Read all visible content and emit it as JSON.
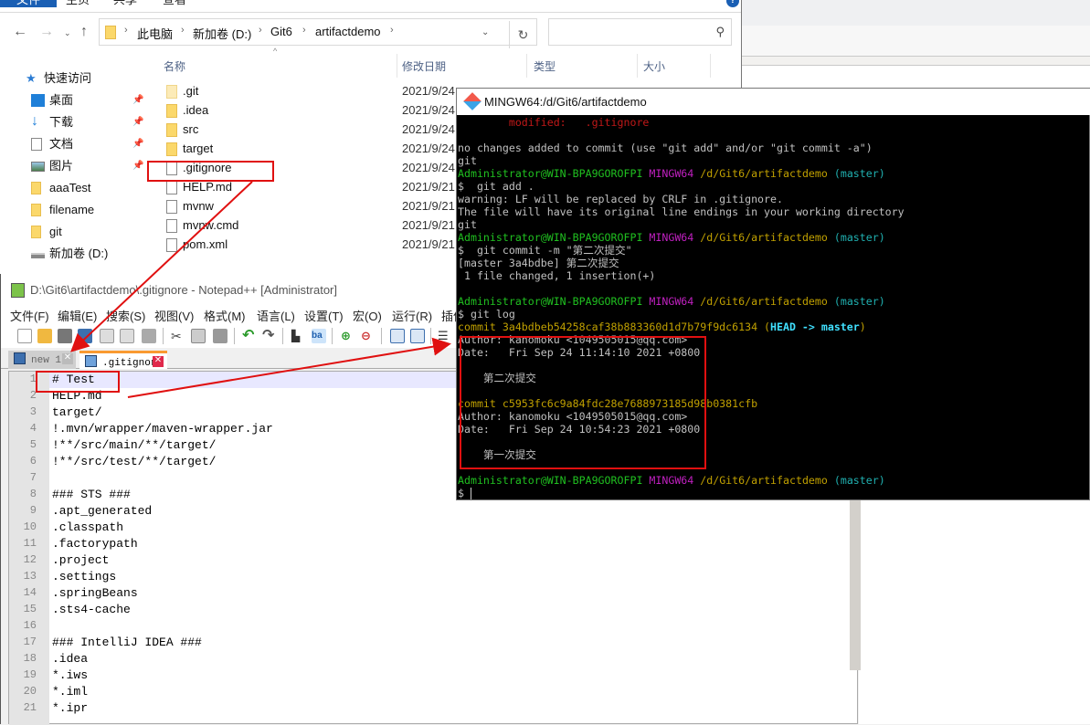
{
  "explorer": {
    "ribbon_tabs": [
      "文件",
      "主页",
      "共享",
      "查看"
    ],
    "breadcrumb": [
      "此电脑",
      "新加卷 (D:)",
      "Git6",
      "artifactdemo"
    ],
    "search_placeholder": "",
    "columns": [
      "名称",
      "修改日期",
      "类型",
      "大小"
    ],
    "sidebar": [
      {
        "label": "快速访问",
        "icon": "star-icon"
      },
      {
        "label": "桌面",
        "icon": "desktop-icon",
        "pinned": true
      },
      {
        "label": "下载",
        "icon": "download-icon",
        "pinned": true
      },
      {
        "label": "文档",
        "icon": "document-icon",
        "pinned": true
      },
      {
        "label": "图片",
        "icon": "pictures-icon",
        "pinned": true
      },
      {
        "label": "aaaTest",
        "icon": "folder-icon"
      },
      {
        "label": "filename",
        "icon": "folder-icon"
      },
      {
        "label": "git",
        "icon": "folder-icon"
      },
      {
        "label": "新加卷 (D:)",
        "icon": "drive-icon"
      }
    ],
    "files": [
      {
        "name": ".git",
        "date": "2021/9/24",
        "icon": "folder-icon"
      },
      {
        "name": ".idea",
        "date": "2021/9/24",
        "icon": "folder-icon"
      },
      {
        "name": "src",
        "date": "2021/9/24",
        "icon": "folder-icon"
      },
      {
        "name": "target",
        "date": "2021/9/24",
        "icon": "folder-icon"
      },
      {
        "name": ".gitignore",
        "date": "2021/9/24",
        "icon": "text-file-icon"
      },
      {
        "name": "HELP.md",
        "date": "2021/9/21",
        "icon": "file-icon"
      },
      {
        "name": "mvnw",
        "date": "2021/9/21",
        "icon": "file-icon"
      },
      {
        "name": "mvnw.cmd",
        "date": "2021/9/21",
        "icon": "cmd-file-icon"
      },
      {
        "name": "pom.xml",
        "date": "2021/9/21",
        "icon": "xml-file-icon"
      }
    ]
  },
  "notepad": {
    "title": "D:\\Git6\\artifactdemo\\.gitignore - Notepad++ [Administrator]",
    "menus": [
      "文件(F)",
      "编辑(E)",
      "搜索(S)",
      "视图(V)",
      "格式(M)",
      "语言(L)",
      "设置(T)",
      "宏(O)",
      "运行(R)",
      "插件"
    ],
    "tabs": [
      {
        "label": "new 1",
        "active": false
      },
      {
        "label": ".gitignore",
        "active": true
      }
    ],
    "lines": [
      "# Test",
      "HELP.md",
      "target/",
      "!.mvn/wrapper/maven-wrapper.jar",
      "!**/src/main/**/target/",
      "!**/src/test/**/target/",
      "",
      "### STS ###",
      ".apt_generated",
      ".classpath",
      ".factorypath",
      ".project",
      ".settings",
      ".springBeans",
      ".sts4-cache",
      "",
      "### IntelliJ IDEA ###",
      ".idea",
      "*.iws",
      "*.iml",
      "*.ipr"
    ]
  },
  "terminal": {
    "title": "MINGW64:/d/Git6/artifactdemo",
    "prompt_user": "Administrator@WIN-BPA9GOROFPI",
    "prompt_env": "MINGW64",
    "prompt_path": "/d/Git6/artifactdemo",
    "prompt_branch": "(master)",
    "modified_line": "        modified:   .gitignore",
    "no_changes": "no changes added to commit (use \"git add\" and/or \"git commit -a\")",
    "git": "git",
    "cmd_add": "$  git add .",
    "warning1": "warning: LF will be replaced by CRLF in .gitignore.",
    "warning2": "The file will have its original line endings in your working directory",
    "cmd_commit": "$  git commit -m \"第二次提交\"",
    "commit_result1": "[master 3a4bdbe] 第二次提交",
    "commit_result2": " 1 file changed, 1 insertion(+)",
    "cmd_log": "$ git log",
    "commit1_hash": "commit 3a4bdbeb54258caf38b883360d1d7b79f9dc6134",
    "commit1_head": "HEAD -> master",
    "commit1_author": "Author: kanomoku <1049505015@qq.com>",
    "commit1_date": "Date:   Fri Sep 24 11:14:10 2021 +0800",
    "commit1_msg": "    第二次提交",
    "commit2_hash": "commit c5953fc6c9a84fdc28e7688973185d98b0381cfb",
    "commit2_author": "Author: kanomoku <1049505015@qq.com>",
    "commit2_date": "Date:   Fri Sep 24 10:54:23 2021 +0800",
    "commit2_msg": "    第一次提交",
    "final_prompt": "$ "
  }
}
